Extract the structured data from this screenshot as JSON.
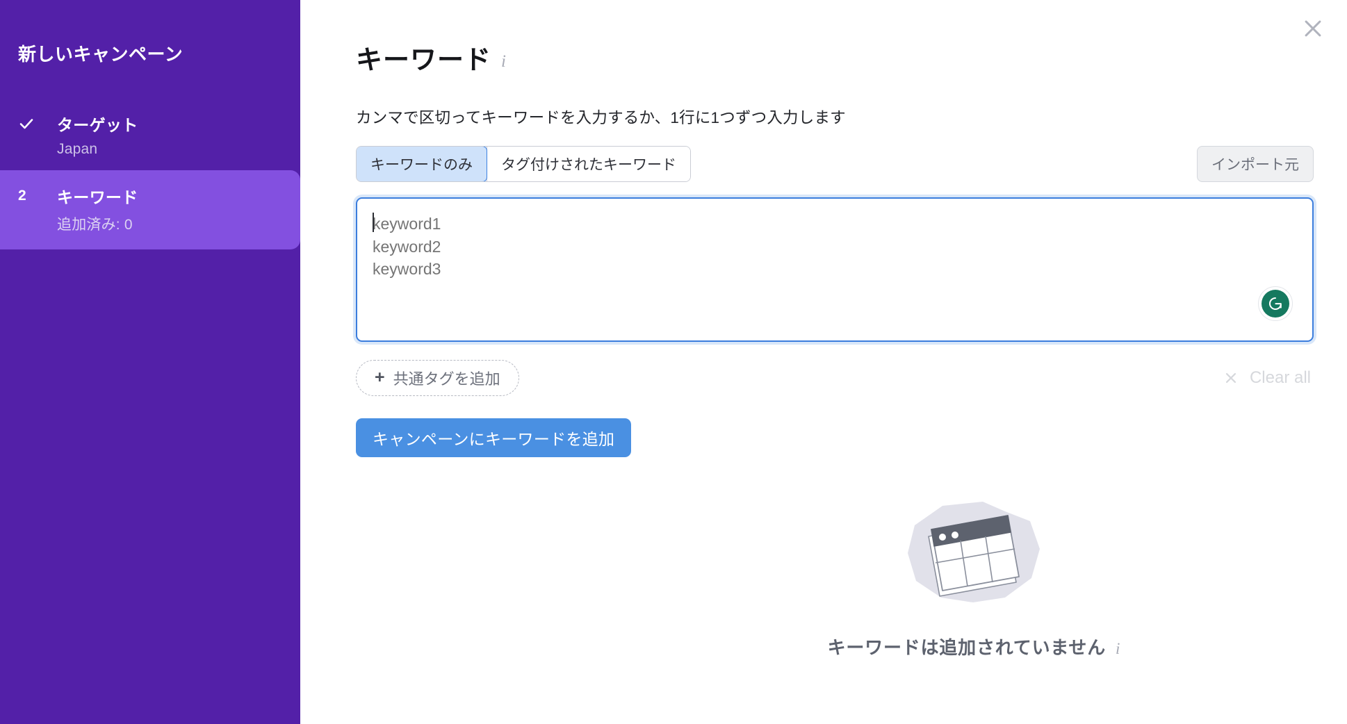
{
  "sidebar": {
    "title": "新しいキャンペーン",
    "accent_color": "#5320a8",
    "active_color": "#8350e0",
    "items": [
      {
        "marker": "check-icon",
        "label": "ターゲット",
        "sub": "Japan",
        "active": false
      },
      {
        "marker": "2",
        "label": "キーワード",
        "sub": "追加済み: 0",
        "active": true
      }
    ]
  },
  "main": {
    "close_label": "×",
    "page_title": "キーワード",
    "title_info_icon": "i",
    "subtitle": "カンマで区切ってキーワードを入力するか、1行に1つずつ入力します",
    "tabs": [
      {
        "label": "キーワードのみ",
        "active": true
      },
      {
        "label": "タグ付けされたキーワード",
        "active": false
      }
    ],
    "import_button": "インポート元",
    "textarea": {
      "value": "",
      "placeholder": "keyword1\nkeyword2\nkeyword3",
      "border_color": "#3b7ddd"
    },
    "grammarly_icon": "G",
    "add_tag_button": "共通タグを追加",
    "add_tag_plus": "+",
    "clear_all": "Clear all",
    "primary_button": "キャンペーンにキーワードを追加",
    "primary_button_color": "#4a90e2",
    "empty_state": {
      "message": "キーワードは追加されていません",
      "info_icon": "i"
    }
  }
}
